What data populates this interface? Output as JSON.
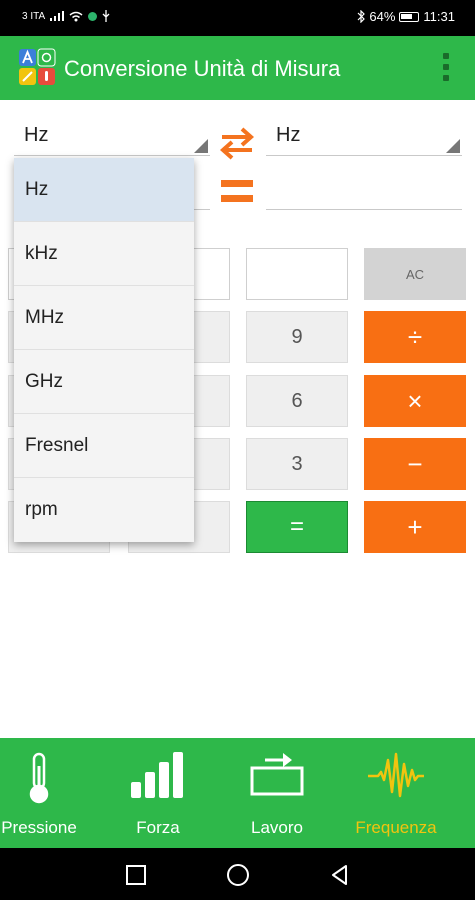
{
  "status_bar": {
    "carrier": "3 ITA",
    "battery": "64%",
    "time": "11:31"
  },
  "app_bar": {
    "title": "Conversione Unità di Misura"
  },
  "converter": {
    "from_unit": "Hz",
    "to_unit": "Hz",
    "from_value": "",
    "to_value": ""
  },
  "dropdown": {
    "items": [
      "Hz",
      "kHz",
      "MHz",
      "GHz",
      "Fresnel",
      "rpm"
    ],
    "selected": "Hz"
  },
  "keypad": {
    "ac": "AC",
    "nine": "9",
    "six": "6",
    "three": "3",
    "equals": "=",
    "divide": "÷",
    "multiply": "×",
    "minus": "−",
    "plus": "+"
  },
  "bottom_nav": {
    "items": [
      {
        "label": "Pressione",
        "icon": "thermometer-icon",
        "active": false
      },
      {
        "label": "Forza",
        "icon": "signal-bars-icon",
        "active": false
      },
      {
        "label": "Lavoro",
        "icon": "work-arrow-icon",
        "active": false
      },
      {
        "label": "Frequenza",
        "icon": "waveform-icon",
        "active": true
      }
    ]
  },
  "colors": {
    "accent": "#2eb84a",
    "operator": "#f86f13",
    "active_nav": "#f1c40f"
  }
}
